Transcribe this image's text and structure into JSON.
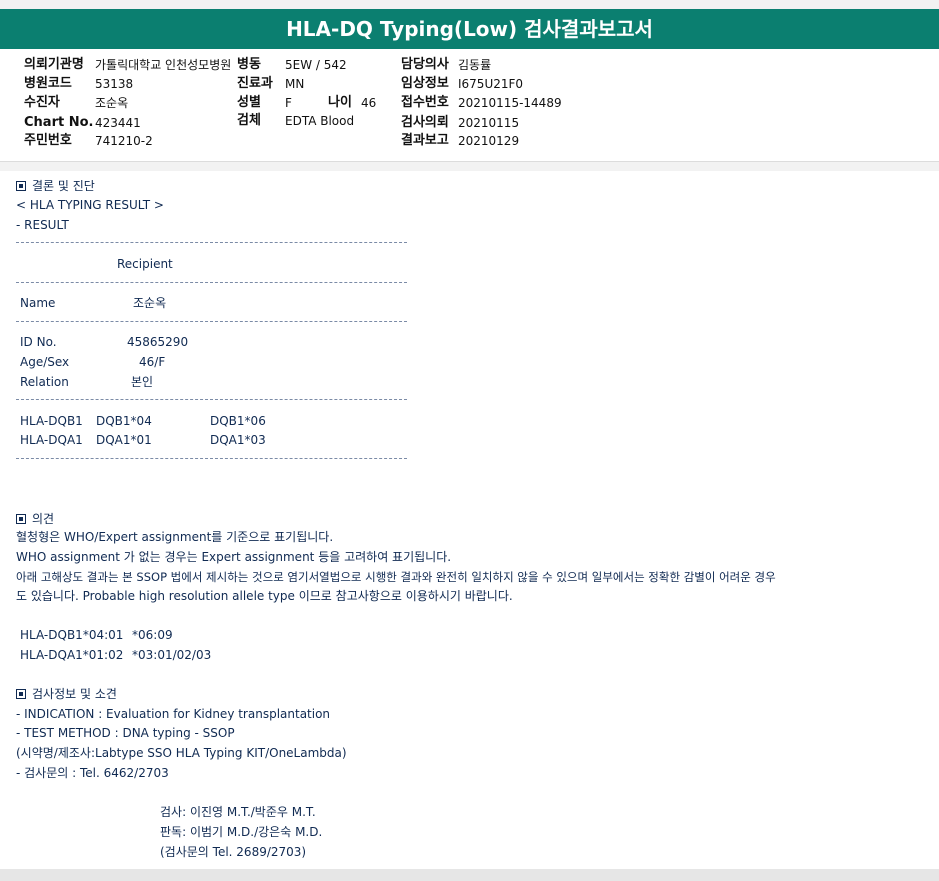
{
  "title": "HLA-DQ Typing(Low) 검사결과보고서",
  "info": {
    "requesting_org_label": "의뢰기관명",
    "requesting_org": "가톨릭대학교 인천성모병원",
    "hospital_code_label": "병원코드",
    "hospital_code": "53138",
    "patient_label": "수진자",
    "patient": "조순옥",
    "chart_no_label": "Chart No.",
    "chart_no": "423441",
    "resident_no_label": "주민번호",
    "resident_no": "741210-2",
    "ward_label": "병동",
    "ward": "5EW / 542",
    "dept_label": "진료과",
    "dept": "MN",
    "sex_label": "성별",
    "sex": "F",
    "age_label": "나이",
    "age": "46",
    "specimen_label": "검체",
    "specimen": "EDTA Blood",
    "doctor_label": "담당의사",
    "doctor": "김동률",
    "clinical_info_label": "임상정보",
    "clinical_info": "I675U21F0",
    "receipt_no_label": "접수번호",
    "receipt_no": "20210115-14489",
    "test_request_label": "검사의뢰",
    "test_request": "20210115",
    "result_report_label": "결과보고",
    "result_report": "20210129"
  },
  "result": {
    "section1_title": "결론 및 진단",
    "hla_result_header": "< HLA TYPING RESULT >",
    "result_label": "- RESULT",
    "recipient": "Recipient",
    "name_label": "Name",
    "name_value": "조순옥",
    "id_label": "ID No.",
    "id_value": "45865290",
    "agesex_label": "Age/Sex",
    "agesex_value": "46/F",
    "relation_label": "Relation",
    "relation_value": "본인",
    "dqb1_locus": "HLA-DQB1",
    "dqb1_a1": "DQB1*04",
    "dqb1_a2": "DQB1*06",
    "dqa1_locus": "HLA-DQA1",
    "dqa1_a1": "DQA1*01",
    "dqa1_a2": "DQA1*03",
    "section2_title": "의견",
    "opinion_1": "혈청형은 WHO/Expert assignment를 기준으로 표기됩니다.",
    "opinion_2": "WHO  assignment 가 없는 경우는 Expert assignment 등을 고려하여 표기됩니다.",
    "opinion_3": "아래 고해상도 결과는 본 SSOP 법에서 제시하는 것으로 염기서열법으로 시행한 결과와 완전히 일치하지 않을 수 있으며 일부에서는 정확한 감별이 어려운 경우",
    "opinion_4": "도 있습니다. Probable high resolution allele type 이므로 참고사항으로 이용하시기 바랍니다.",
    "highres_1_locus": "HLA-DQB1*04:01",
    "highres_1_alt": "*06:09",
    "highres_2_locus": "HLA-DQA1*01:02",
    "highres_2_alt": "*03:01/02/03",
    "section3_title": "검사정보 및 소견",
    "indication": "- INDICATION    : Evaluation for Kidney transplantation",
    "method": "- TEST METHOD : DNA typing - SSOP",
    "reagent": "(시약명/제조사:Labtype SSO HLA Typing KIT/OneLambda)",
    "inquiry": "- 검사문의 : Tel. 6462/2703",
    "tested_by": "검사: 이진영 M.T./박준우 M.T.",
    "read_by": "판독: 이범기 M.D./강은숙 M.D.",
    "inquiry2": "(검사문의 Tel. 2689/2703)"
  }
}
